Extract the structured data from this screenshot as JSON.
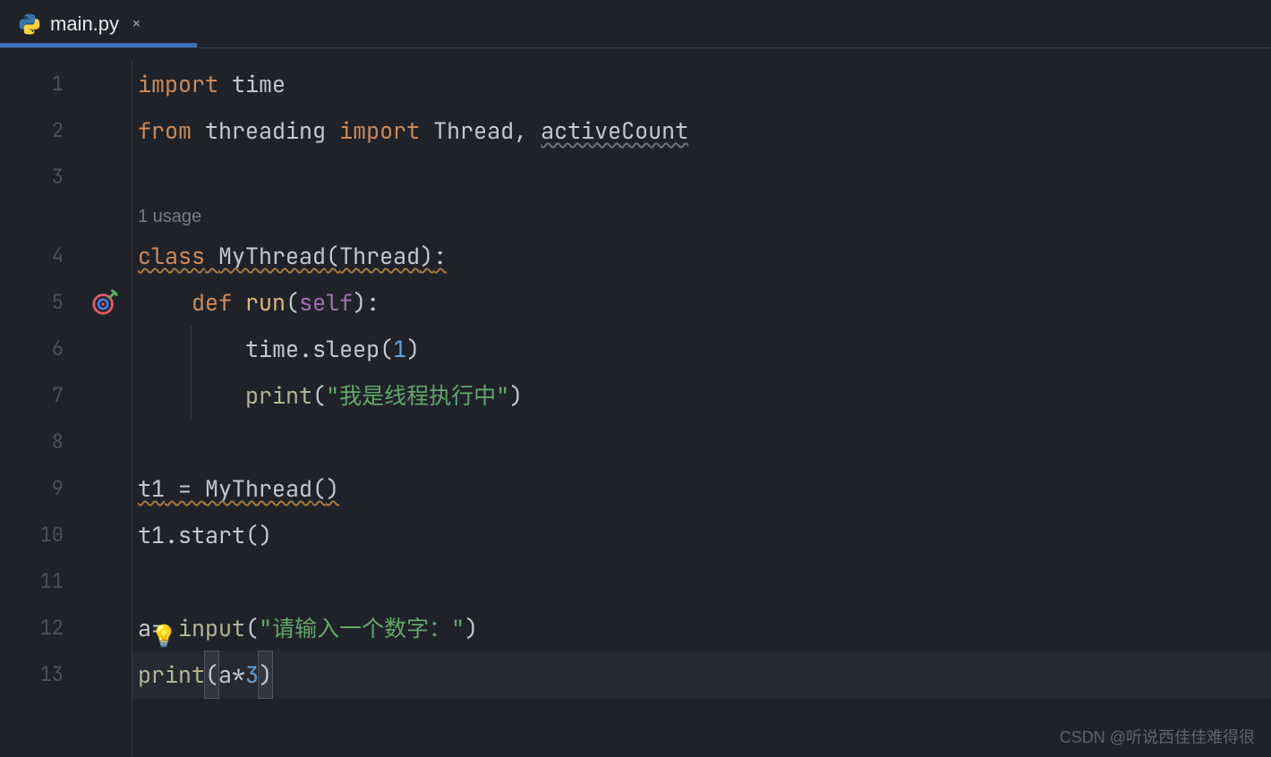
{
  "tab": {
    "filename": "main.py",
    "close_glyph": "×"
  },
  "gutter": {
    "numbers": [
      "1",
      "2",
      "3",
      "4",
      "5",
      "6",
      "7",
      "8",
      "9",
      "10",
      "11",
      "12",
      "13"
    ]
  },
  "inlay": {
    "usages": "1 usage"
  },
  "code": {
    "l1": {
      "kw_import": "import",
      "sp": " ",
      "ident_time": "time"
    },
    "l2": {
      "kw_from": "from",
      "ident_threading": "threading",
      "kw_import": "import",
      "ident_Thread": "Thread",
      "comma": ",",
      "ident_activeCount": "activeCount"
    },
    "l4": {
      "kw_class": "class",
      "cls_MyThread": "MyThread",
      "lp": "(",
      "ident_Thread": "Thread",
      "rp": ")",
      "colon": ":"
    },
    "l5": {
      "kw_def": "def",
      "fn_run": "run",
      "lp": "(",
      "param_self": "self",
      "rp": ")",
      "colon": ":"
    },
    "l6": {
      "ident_time": "time",
      "dot": ".",
      "fn_sleep": "sleep",
      "lp": "(",
      "num_1": "1",
      "rp": ")"
    },
    "l7": {
      "fn_print": "print",
      "lp": "(",
      "str": "\"我是线程执行中\"",
      "rp": ")"
    },
    "l9": {
      "ident_t1": "t1",
      "eq": " = ",
      "cls_MyThread": "MyThread",
      "lp": "(",
      "rp": ")"
    },
    "l10": {
      "ident_t1": "t1",
      "dot": ".",
      "fn_start": "start",
      "lp": "(",
      "rp": ")"
    },
    "l12": {
      "ident_a": "a",
      "eq": "= ",
      "fn_input": "input",
      "lp": "(",
      "str": "\"请输入一个数字：\"",
      "rp": ")"
    },
    "l13": {
      "fn_print": "print",
      "lp": "(",
      "ident_a": "a",
      "mul": "*",
      "num_3": "3",
      "rp": ")"
    }
  },
  "watermark": "CSDN @听说西佳佳难得很"
}
